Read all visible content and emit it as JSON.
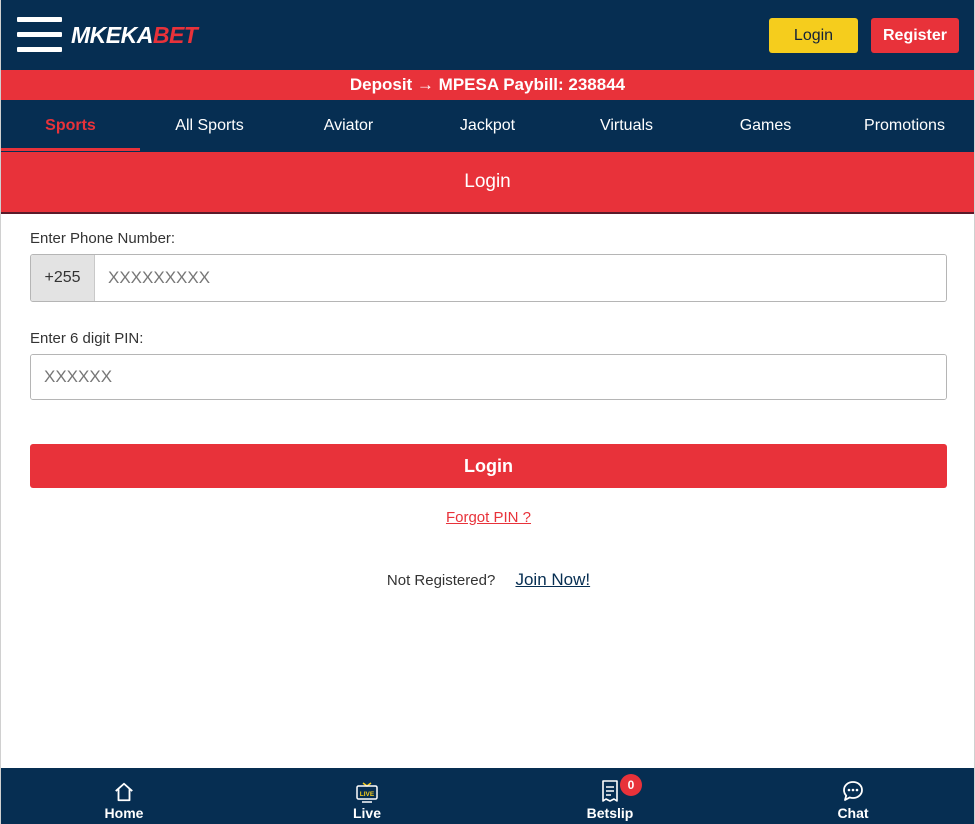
{
  "header": {
    "logo_main": "MKEKA",
    "logo_accent": "BET",
    "login_label": "Login",
    "register_label": "Register"
  },
  "banner": {
    "text": "Deposit → MPESA Paybill: 238844"
  },
  "nav": {
    "items": [
      {
        "label": "Sports"
      },
      {
        "label": "All Sports"
      },
      {
        "label": "Aviator"
      },
      {
        "label": "Jackpot"
      },
      {
        "label": "Virtuals"
      },
      {
        "label": "Games"
      },
      {
        "label": "Promotions"
      }
    ]
  },
  "login_form": {
    "title": "Login",
    "phone_label": "Enter Phone Number:",
    "phone_prefix": "+255",
    "phone_placeholder": "XXXXXXXXX",
    "pin_label": "Enter 6 digit PIN:",
    "pin_placeholder": "XXXXXX",
    "submit_label": "Login",
    "forgot_label": "Forgot PIN ?",
    "not_registered": "Not Registered?",
    "join_label": "Join Now!"
  },
  "bottom_nav": {
    "home": "Home",
    "live": "Live",
    "live_icon_text": "LIVE",
    "betslip": "Betslip",
    "betslip_count": "0",
    "chat": "Chat"
  },
  "colors": {
    "navy": "#062e52",
    "red": "#e8323a",
    "yellow": "#f5cd1d"
  }
}
